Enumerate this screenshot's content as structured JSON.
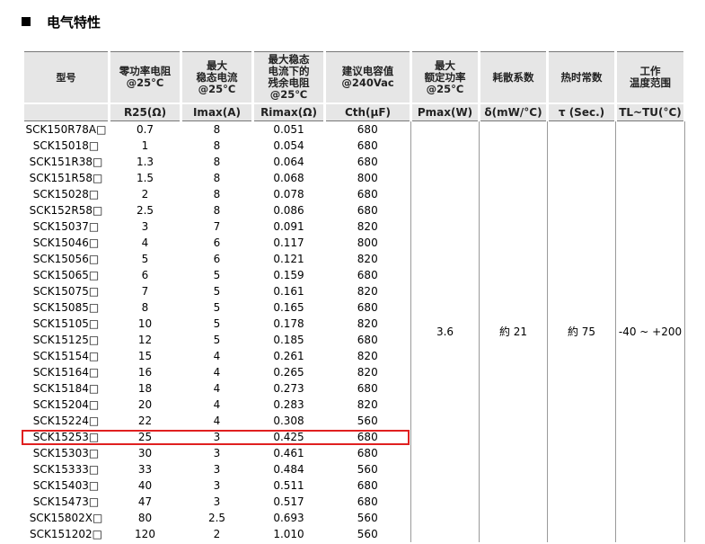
{
  "section": {
    "title": "电气特性"
  },
  "table": {
    "headers": [
      "型号",
      "零功率电阻\n@25°C",
      "最大\n稳态电流\n@25°C",
      "最大稳态\n电流下的\n残余电阻\n@25℃",
      "建议电容值\n@240Vac",
      "最大\n额定功率\n@25°C",
      "耗散系数",
      "热时常数",
      "工作\n温度范围"
    ],
    "units": [
      "",
      "R25(Ω)",
      "Imax(A)",
      "Rimax(Ω)",
      "Cth(µF)",
      "Pmax(W)",
      "δ(mW/°C)",
      "τ (Sec.)",
      "TL~TU(°C)"
    ],
    "merged": {
      "pmax": "3.6",
      "dissipation": "約 21",
      "thermal": "約 75",
      "temp_range": "-40 ~ +200"
    },
    "rows": [
      [
        "SCK150R78A□",
        "0.7",
        "8",
        "0.051",
        "680"
      ],
      [
        "SCK15018□",
        "1",
        "8",
        "0.054",
        "680"
      ],
      [
        "SCK151R38□",
        "1.3",
        "8",
        "0.064",
        "680"
      ],
      [
        "SCK151R58□",
        "1.5",
        "8",
        "0.068",
        "800"
      ],
      [
        "SCK15028□",
        "2",
        "8",
        "0.078",
        "680"
      ],
      [
        "SCK152R58□",
        "2.5",
        "8",
        "0.086",
        "680"
      ],
      [
        "SCK15037□",
        "3",
        "7",
        "0.091",
        "820"
      ],
      [
        "SCK15046□",
        "4",
        "6",
        "0.117",
        "800"
      ],
      [
        "SCK15056□",
        "5",
        "6",
        "0.121",
        "820"
      ],
      [
        "SCK15065□",
        "6",
        "5",
        "0.159",
        "680"
      ],
      [
        "SCK15075□",
        "7",
        "5",
        "0.161",
        "820"
      ],
      [
        "SCK15085□",
        "8",
        "5",
        "0.165",
        "680"
      ],
      [
        "SCK15105□",
        "10",
        "5",
        "0.178",
        "820"
      ],
      [
        "SCK15125□",
        "12",
        "5",
        "0.185",
        "680"
      ],
      [
        "SCK15154□",
        "15",
        "4",
        "0.261",
        "820"
      ],
      [
        "SCK15164□",
        "16",
        "4",
        "0.265",
        "820"
      ],
      [
        "SCK15184□",
        "18",
        "4",
        "0.273",
        "680"
      ],
      [
        "SCK15204□",
        "20",
        "4",
        "0.283",
        "820"
      ],
      [
        "SCK15224□",
        "22",
        "4",
        "0.308",
        "560"
      ],
      [
        "SCK15253□",
        "25",
        "3",
        "0.425",
        "680"
      ],
      [
        "SCK15303□",
        "30",
        "3",
        "0.461",
        "680"
      ],
      [
        "SCK15333□",
        "33",
        "3",
        "0.484",
        "560"
      ],
      [
        "SCK15403□",
        "40",
        "3",
        "0.511",
        "680"
      ],
      [
        "SCK15473□",
        "47",
        "3",
        "0.517",
        "680"
      ],
      [
        "SCK15802X□",
        "80",
        "2.5",
        "0.693",
        "560"
      ],
      [
        "SCK151202□",
        "120",
        "2",
        "1.010",
        "560"
      ]
    ],
    "highlight_row": 19,
    "highlight_color": "#e02020"
  }
}
